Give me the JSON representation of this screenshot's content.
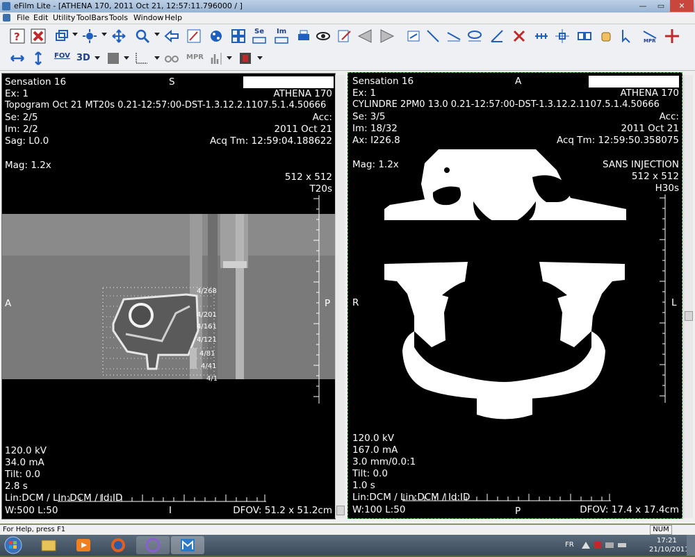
{
  "window": {
    "title": "eFilm Lite - [ATHENA 170, 2011 Oct 21, 12:57:11.796000  / ]",
    "min_label": "—",
    "max_label": "▭",
    "close_label": "✕"
  },
  "menu": [
    "File",
    "Edit",
    "Utility",
    "ToolBars",
    "Tools",
    "Window",
    "Help"
  ],
  "toolbar": {
    "se_label": "Se",
    "im_label": "Im",
    "fov_label": "FOV",
    "threed_label": "3D",
    "mpr_label": "MPR",
    "mpr_icon_label": "MPR",
    "colors": {
      "blue": "#1f5fbf",
      "red": "#c0282a",
      "accent": "#1f3f8f"
    }
  },
  "left_viewer": {
    "manufacturer": "Sensation 16",
    "orientation_top": "S",
    "patient": "ATHENA 170",
    "exam": "Ex: 1",
    "study_line": "Topogram  Oct 21 MT20s 0.21-12:57:00-DST-1.3.12.2.1107.5.1.4.50666",
    "series": "Se: 2/5",
    "acc": "Acc:",
    "image": "Im: 2/2",
    "date": "2011 Oct 21",
    "location": "Sag: L0.0",
    "acq_time": "Acq Tm: 12:59:04.188622",
    "magnification": "Mag: 1.2x",
    "matrix": "512 x 512",
    "kernel": "T20s",
    "orientation_left": "A",
    "orientation_right": "P",
    "orientation_bottom": "I",
    "kv": "120.0 kV",
    "ma": "34.0 mA",
    "tilt": "Tilt: 0.0",
    "time": "2.8 s",
    "lut": "Lin:DCM / Lin:DCM / Id:ID",
    "window_level": "W:500  L:50",
    "dfov": "DFOV: 51.2 x 51.2cm",
    "slice_labels": [
      "4/268",
      "4/201",
      "4/161",
      "4/121",
      "4/81",
      "4/41",
      "4/1"
    ]
  },
  "right_viewer": {
    "manufacturer": "Sensation 16",
    "orientation_top": "A",
    "patient": "ATHENA 170",
    "exam": "Ex: 1",
    "study_line": "CYLINDRE 2PM0 13.0 0.21-12:57:00-DST-1.3.12.2.1107.5.1.4.50666",
    "series": "Se: 3/5",
    "acc": "Acc:",
    "image": "Im: 18/32",
    "date": "2011 Oct 21",
    "location": "Ax: I226.8",
    "acq_time": "Acq Tm: 12:59:50.358075",
    "magnification": "Mag: 1.2x",
    "comment": "SANS  INJECTION",
    "matrix": "512 x 512",
    "kernel": "H30s",
    "orientation_left": "R",
    "orientation_right": "L",
    "orientation_bottom": "P",
    "kv": "120.0 kV",
    "ma": "167.0 mA",
    "thickness": "3.0 mm/0.0:1",
    "tilt": "Tilt: 0.0",
    "time": "1.0 s",
    "lut": "Lin:DCM / Lin:DCM / Id:ID",
    "window_level": "W:100  L:50",
    "dfov": "DFOV: 17.4 x 17.4cm"
  },
  "status": {
    "help": "For Help, press F1",
    "num": "NUM"
  },
  "taskbar": {
    "lang": "FR",
    "time": "17:21",
    "date": "21/10/2011"
  }
}
